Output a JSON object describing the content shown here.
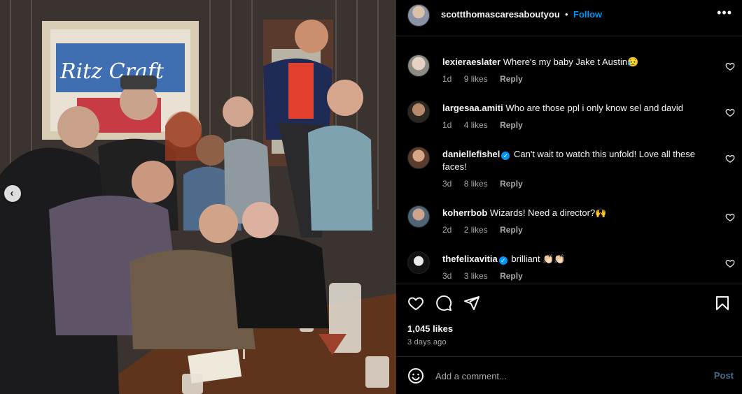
{
  "post": {
    "author": "scottthomascaresaboutyou",
    "dot": "•",
    "follow_label": "Follow",
    "more_label": "•••",
    "photo_sign_text": "Ritz Craft"
  },
  "comments": [
    {
      "username": "lexieraeslater",
      "verified": false,
      "text": "Where's my baby Jake t Austin😥",
      "age": "1d",
      "likes": "9 likes",
      "reply": "Reply"
    },
    {
      "username": "largesaa.amiti",
      "verified": false,
      "text": "Who are those ppl i only know sel and david",
      "age": "1d",
      "likes": "4 likes",
      "reply": "Reply"
    },
    {
      "username": "daniellefishel",
      "verified": true,
      "text": "Can't wait to watch this unfold! Love all these faces!",
      "age": "3d",
      "likes": "8 likes",
      "reply": "Reply"
    },
    {
      "username": "koherrbob",
      "verified": false,
      "text": "Wizards! Need a director?🙌",
      "age": "2d",
      "likes": "2 likes",
      "reply": "Reply"
    },
    {
      "username": "thefelixavitia",
      "verified": true,
      "text": "brilliant 👏🏻👏🏻",
      "age": "3d",
      "likes": "3 likes",
      "reply": "Reply"
    }
  ],
  "engagement": {
    "likes": "1,045 likes",
    "posted": "3 days ago"
  },
  "composer": {
    "placeholder": "Add a comment...",
    "post_label": "Post"
  },
  "icons": {
    "like": "heart-icon",
    "comment": "comment-bubble-icon",
    "share": "paper-plane-icon",
    "save": "bookmark-icon",
    "emoji": "emoji-smile-icon",
    "prev": "chevron-left-icon"
  },
  "colors": {
    "accent": "#0095f6",
    "muted": "#a8a8a8",
    "divider": "#262626"
  }
}
